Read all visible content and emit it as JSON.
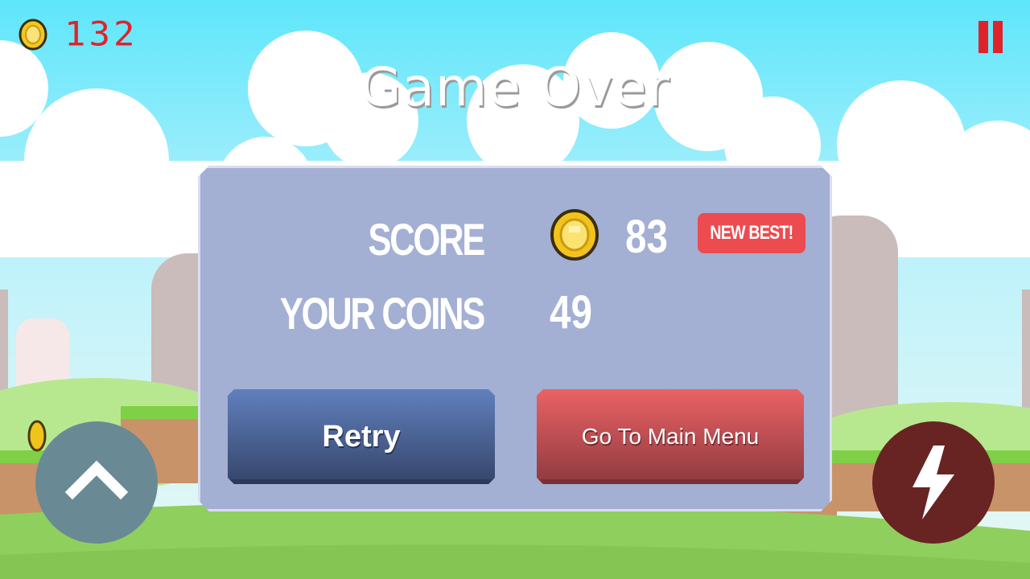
{
  "hud": {
    "coin_total": "132",
    "coin_icon": "coin-icon",
    "pause_icon": "pause-icon"
  },
  "title": "Game Over",
  "panel": {
    "score_label": "SCORE",
    "score_value": "83",
    "new_best": "NEW BEST!",
    "coins_label": "YOUR COINS",
    "coins_value": "49"
  },
  "buttons": {
    "retry": "Retry",
    "main_menu": "Go To Main Menu"
  },
  "controls": {
    "jump_icon": "chevron-up-icon",
    "boost_icon": "lightning-icon"
  },
  "colors": {
    "sky_top": "#5ee6fb",
    "panel": "#a3afd3",
    "accent_red": "#e0232b",
    "new_best": "#ec4b4f",
    "retry": "#4d6aa3",
    "menu": "#d3575b",
    "jump_button": "#698a95",
    "boost_button": "#672422"
  }
}
